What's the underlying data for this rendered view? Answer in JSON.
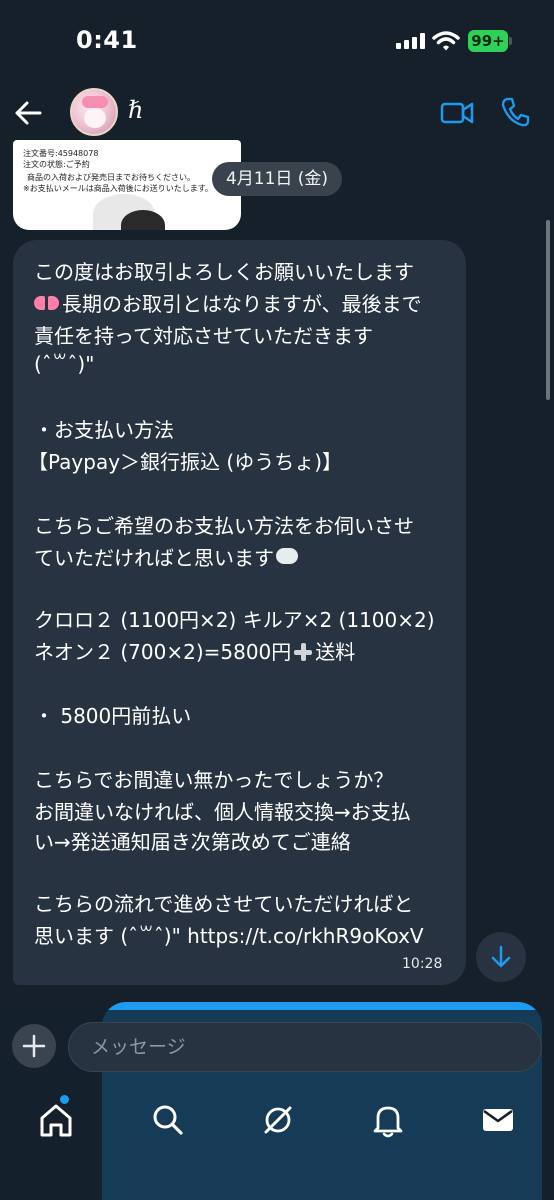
{
  "status_bar": {
    "time": "0:41",
    "battery": "99+"
  },
  "header": {
    "contact_name": "ℏ",
    "icons": [
      "back-arrow-icon",
      "video-call-icon",
      "phone-call-icon"
    ]
  },
  "media_preview": {
    "lines": [
      "注文番号:45948078",
      "注文の状態:ご予約",
      "商品の入荷および発売日までお待ちください。",
      "※お支払いメールは商品入荷後にお送りいたします。"
    ]
  },
  "date_chip": "4月11日 (金)",
  "message": {
    "lines": [
      "この度はお取引よろしくお願いいたします",
      "長期のお取引とはなりますが、最後まで",
      "責任を持って対応させていただきます",
      "(ˆ꒳ˆ)\"",
      "・お支払い方法",
      "【Paypay＞銀行振込 (ゆうちょ)】",
      "こちらご希望のお支払い方法をお伺いさせ",
      "ていただければと思います",
      "クロロ２ (1100円×2) キルア×2 (1100×2)",
      "ネオン２ (700×2)=5800円",
      "送料",
      "・ 5800円前払い",
      "こちらでお間違い無かったでしょうか？",
      "お間違いなければ、個人情報交換→お支払",
      "い→発送通知届き次第改めてご連絡",
      "こちらの流れで進めさせていただければと",
      "思います (ˆ꒳ˆ)\" https://t.co/rkhR9oKoxV"
    ],
    "emojis": [
      "ribbon-emoji",
      "thought-balloon-emoji",
      "heavy-plus-emoji"
    ],
    "time": "10:28",
    "colors": {
      "incoming_bubble": "#273340",
      "outgoing_bubble": "#1d9bf0"
    }
  },
  "composer": {
    "placeholder": "メッセージ"
  },
  "tab_bar": {
    "items": [
      "home-icon",
      "search-icon",
      "grok-icon",
      "notifications-icon",
      "messages-icon"
    ],
    "active": "home-icon"
  },
  "theme": {
    "background": "#15202b",
    "accent": "#1d9bf0",
    "battery_green": "#2fd158"
  }
}
